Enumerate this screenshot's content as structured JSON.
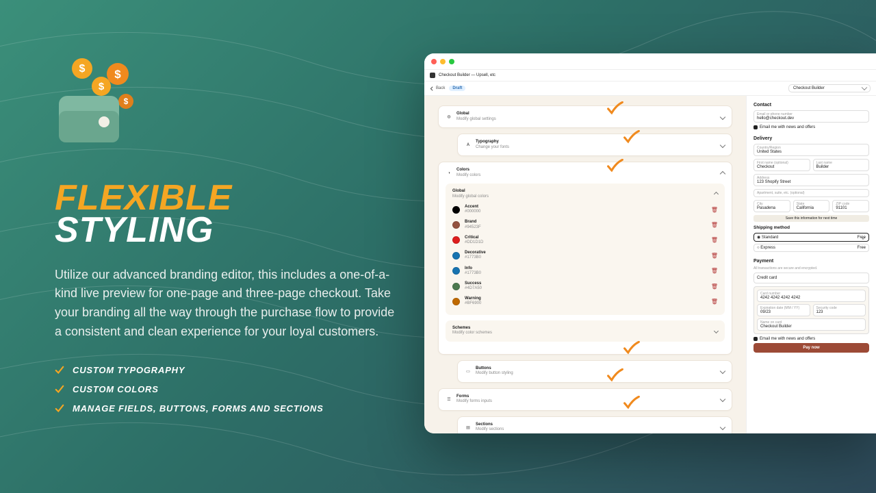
{
  "hero": {
    "title_line1": "Flexible",
    "title_line2": "Styling",
    "body": "Utilize our advanced branding editor, this includes a one-of-a-kind live preview for one-page and three-page checkout. Take your branding all the way through the purchase flow to provide a consistent and clean experience for your loyal customers.",
    "bullets": [
      "Custom Typography",
      "Custom Colors",
      "Manage Fields, Buttons, Forms and Sections"
    ]
  },
  "app": {
    "traffic": [
      "#ff5f57",
      "#febc2e",
      "#28c840"
    ],
    "title": "Checkout Builder — Upsell, etc",
    "back": "Back",
    "status": "Draft",
    "selector": "Checkout Builder",
    "panels": {
      "global": {
        "title": "Global",
        "subtitle": "Modify global settings"
      },
      "typography": {
        "title": "Typography",
        "subtitle": "Change your fonts"
      },
      "colors": {
        "title": "Colors",
        "subtitle": "Modify colors"
      },
      "colors_global": {
        "title": "Global",
        "subtitle": "Modify global colors"
      },
      "schemes": {
        "title": "Schemes",
        "subtitle": "Modify color schemes"
      },
      "buttons": {
        "title": "Buttons",
        "subtitle": "Modify button styling"
      },
      "forms": {
        "title": "Forms",
        "subtitle": "Modify forms inputs"
      },
      "sections": {
        "title": "Sections",
        "subtitle": "Modify sections"
      }
    },
    "swatches": [
      {
        "name": "Accent",
        "hex": "#000000"
      },
      {
        "name": "Brand",
        "hex": "#94523F"
      },
      {
        "name": "Critical",
        "hex": "#DD1D1D"
      },
      {
        "name": "Decorative",
        "hex": "#1773B0"
      },
      {
        "name": "Info",
        "hex": "#1773B0"
      },
      {
        "name": "Success",
        "hex": "#4D7A50"
      },
      {
        "name": "Warning",
        "hex": "#BF6900"
      }
    ]
  },
  "preview": {
    "contact": {
      "h": "Contact",
      "field_label": "Email or phone number",
      "field_value": "hello@checkout.dev",
      "opt": "Email me with news and offers"
    },
    "delivery": {
      "h": "Delivery",
      "country_label": "Country/Region",
      "country": "United States",
      "first_label": "First name (optional)",
      "first": "Checkout",
      "last_label": "Last name",
      "last": "Builder",
      "addr_label": "Address",
      "addr": "123 Shopify Street",
      "apt_label": "Apartment, suite, etc. (optional)",
      "apt": "",
      "city_label": "City",
      "city": "Pasadena",
      "state_label": "State",
      "state": "California",
      "zip_label": "ZIP code",
      "zip": "91101",
      "save": "Save this information for next time"
    },
    "shipping": {
      "h": "Shipping method",
      "opt1": "Standard",
      "opt2": "Express",
      "free": "Free"
    },
    "payment": {
      "h": "Payment",
      "sub": "All transactions are secure and encrypted.",
      "credit": "Credit card",
      "card_label": "Card number",
      "card": "4242 4242 4242 4242",
      "exp_label": "Expiration date (MM / YY)",
      "exp": "09/23",
      "cvc_label": "Security code",
      "cvc": "123",
      "name_label": "Name on card",
      "name": "Checkout Builder",
      "opt": "Email me with news and offers",
      "btn": "Pay now"
    }
  }
}
